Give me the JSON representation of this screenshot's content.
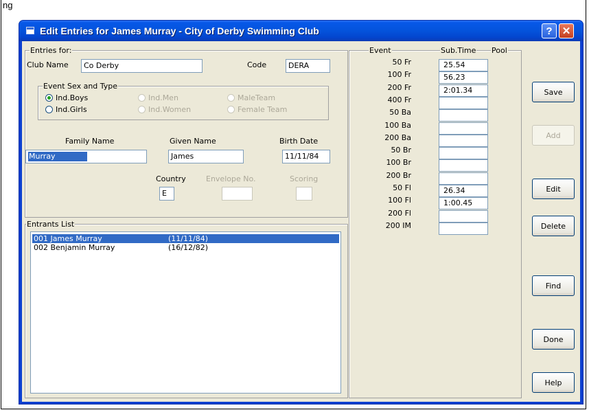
{
  "backdrop": {
    "label": "ng"
  },
  "window": {
    "title": "Edit Entries for James Murray - City of Derby Swimming Club",
    "help_label": "?",
    "close_label": "✕"
  },
  "entries_for": {
    "legend": "Entries for:",
    "club_name_label": "Club Name",
    "club_name_value": "Co Derby",
    "code_label": "Code",
    "code_value": "DERA",
    "event_sex_type": {
      "legend": "Event Sex and Type",
      "options": [
        {
          "label": "Ind.Boys",
          "checked": true,
          "enabled": true
        },
        {
          "label": "Ind.Girls",
          "checked": false,
          "enabled": true
        },
        {
          "label": "Ind.Men",
          "checked": false,
          "enabled": false
        },
        {
          "label": "Ind.Women",
          "checked": false,
          "enabled": false
        },
        {
          "label": "MaleTeam",
          "checked": false,
          "enabled": false
        },
        {
          "label": "Female Team",
          "checked": false,
          "enabled": false
        }
      ]
    },
    "family_name_label": "Family Name",
    "family_name_value": "Murray",
    "given_name_label": "Given Name",
    "given_name_value": "James",
    "birth_date_label": "Birth Date",
    "birth_date_value": "11/11/84",
    "country_label": "Country",
    "country_value": "E",
    "envelope_label": "Envelope No.",
    "envelope_value": "",
    "scoring_label": "Scoring",
    "scoring_value": ""
  },
  "entrants": {
    "legend": "Entrants List",
    "rows": [
      {
        "name": "001 James Murray",
        "dob": "(11/11/84)",
        "selected": true
      },
      {
        "name": "002 Benjamin Murray",
        "dob": "(16/12/82)",
        "selected": false
      }
    ]
  },
  "events": {
    "header_event": "Event",
    "header_subtime": "Sub.Time",
    "header_pool": "Pool",
    "rows": [
      {
        "event": "50 Fr",
        "time": "25.54"
      },
      {
        "event": "100 Fr",
        "time": "56.23"
      },
      {
        "event": "200 Fr",
        "time": "2:01.34"
      },
      {
        "event": "400 Fr",
        "time": ""
      },
      {
        "event": "50 Ba",
        "time": ""
      },
      {
        "event": "100 Ba",
        "time": ""
      },
      {
        "event": "200 Ba",
        "time": ""
      },
      {
        "event": "50 Br",
        "time": ""
      },
      {
        "event": "100 Br",
        "time": ""
      },
      {
        "event": "200 Br",
        "time": ""
      },
      {
        "event": "50 Fl",
        "time": "26.34"
      },
      {
        "event": "100 Fl",
        "time": "1:00.45"
      },
      {
        "event": "200 Fl",
        "time": ""
      },
      {
        "event": "200 IM",
        "time": ""
      }
    ]
  },
  "buttons": {
    "save": "Save",
    "add": "Add",
    "edit": "Edit",
    "delete": "Delete",
    "find": "Find",
    "done": "Done",
    "help": "Help"
  },
  "colors": {
    "titlebar": "#0453db",
    "client": "#ece9d8",
    "selection": "#316ac5"
  }
}
